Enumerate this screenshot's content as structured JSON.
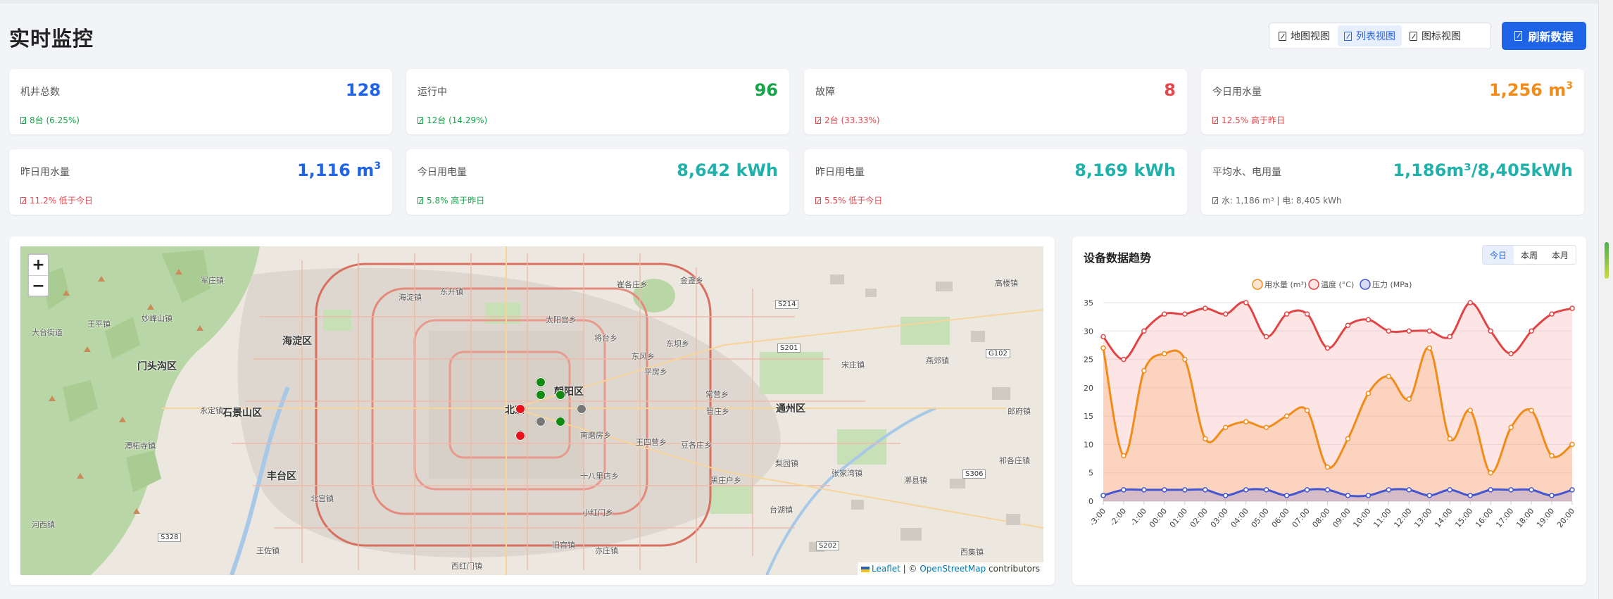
{
  "page": {
    "title": "实时监控"
  },
  "view_switch": {
    "map": "地图视图",
    "list": "列表视图",
    "icon": "图标视图",
    "active": "list"
  },
  "refresh_label": "刷新数据",
  "cards": [
    {
      "label": "机井总数",
      "value": "128",
      "unit": "",
      "color": "#1f63e6",
      "sub": "8台 (6.25%)",
      "sub_color": "#16a34a"
    },
    {
      "label": "运行中",
      "value": "96",
      "unit": "",
      "color": "#16a34a",
      "sub": "12台 (14.29%)",
      "sub_color": "#16a34a"
    },
    {
      "label": "故障",
      "value": "8",
      "unit": "",
      "color": "#e5484d",
      "sub": "2台 (33.33%)",
      "sub_color": "#e5484d"
    },
    {
      "label": "今日用水量",
      "value": "1,256 m",
      "unit": "3",
      "color": "#f08c1a",
      "sub": "12.5% 高于昨日",
      "sub_color": "#e5484d"
    },
    {
      "label": "昨日用水量",
      "value": "1,116 m",
      "unit": "3",
      "color": "#1f63e6",
      "sub": "11.2% 低于今日",
      "sub_color": "#e5484d"
    },
    {
      "label": "今日用电量",
      "value": "8,642 kWh",
      "unit": "",
      "color": "#20b2aa",
      "sub": "5.8% 高于昨日",
      "sub_color": "#16a34a"
    },
    {
      "label": "昨日用电量",
      "value": "8,169 kWh",
      "unit": "",
      "color": "#20b2aa",
      "sub": "5.5% 低于今日",
      "sub_color": "#e5484d"
    },
    {
      "label": "平均水、电用量",
      "value": "1,186m³/8,405kWh",
      "unit": "",
      "color": "#20b2aa",
      "sub": "水: 1,186 m³ | 电: 8,405 kWh",
      "sub_color": "#666"
    }
  ],
  "map": {
    "zoom_in": "+",
    "zoom_out": "−",
    "attribution_leaflet": "Leaflet",
    "attribution_sep": " | © ",
    "attribution_osm": "OpenStreetMap",
    "attribution_tail": " contributors",
    "labels": {
      "haidian": "海淀区",
      "shijingshan": "石景山区",
      "mentougou": "门头沟区",
      "fengtai": "丰台区",
      "chaoyang": "朝阳区",
      "tongzhou": "通州区",
      "beijing": "北京",
      "junzhuang": "军庄镇",
      "miaofengshan": "妙峰山镇",
      "wangping": "王平镇",
      "datai": "大台街道",
      "yongding": "永定镇",
      "tanzhesi": "潭柘寺镇",
      "beigong": "北宫镇",
      "wangzuo": "王佐镇",
      "hexi": "河西镇",
      "haidianzhen": "海淀镇",
      "dongsheng": "东升镇",
      "taiyanggong": "太阳宫乡",
      "jiangtai": "将台乡",
      "cuigezhuang": "崔各庄乡",
      "jinzhan": "金盏乡",
      "dongba": "东坝乡",
      "pingfang": "平房乡",
      "changying": "常营乡",
      "guanzhuang": "管庄乡",
      "songzhuang": "宋庄镇",
      "yanjiao": "燕郊镇",
      "gaolou": "高楼镇",
      "nanmofang": "南磨房乡",
      "wangsiying": "王四营乡",
      "doudian": "豆各庄乡",
      "heizhuanghu": "黑庄户乡",
      "taihu": "台湖镇",
      "liyuan": "梨园镇",
      "zhangjiawan": "张家湾镇",
      "luocheng": "漷县镇",
      "shibalidian": "十八里店乡",
      "xiaohongmen": "小红门乡",
      "jiugong": "旧宫镇",
      "yizhuang": "亦庄镇",
      "xihongmen": "西红门镇",
      "xiji": "西集镇",
      "zhuxinzhuang": "祁各庄镇",
      "jiaozhuang": "郎府镇",
      "dongfengxiang": "东风乡"
    },
    "road_shields": [
      "S214",
      "S201",
      "G102",
      "S306",
      "S202",
      "S328"
    ],
    "markers": [
      {
        "status": "running",
        "color": "#138a12"
      },
      {
        "status": "running",
        "color": "#138a12"
      },
      {
        "status": "running",
        "color": "#138a12"
      },
      {
        "status": "running",
        "color": "#138a12"
      },
      {
        "status": "fault",
        "color": "#e8131a"
      },
      {
        "status": "fault",
        "color": "#e8131a"
      },
      {
        "status": "offline",
        "color": "#777777"
      },
      {
        "status": "offline",
        "color": "#777777"
      }
    ]
  },
  "chart_panel": {
    "title": "设备数据趋势",
    "ranges": [
      "今日",
      "本周",
      "本月"
    ],
    "active_range": "今日"
  },
  "chart_data": {
    "type": "line",
    "x": [
      "-3:00",
      "-2:00",
      "-1:00",
      "00:00",
      "01:00",
      "02:00",
      "03:00",
      "04:00",
      "05:00",
      "06:00",
      "07:00",
      "08:00",
      "09:00",
      "10:00",
      "11:00",
      "12:00",
      "13:00",
      "14:00",
      "15:00",
      "16:00",
      "17:00",
      "18:00",
      "19:00",
      "20:00"
    ],
    "ylim": [
      0,
      35
    ],
    "yticks": [
      0,
      5,
      10,
      15,
      20,
      25,
      30,
      35
    ],
    "grid": true,
    "legend_position": "top",
    "series": [
      {
        "name": "用水量 (m³)",
        "color": "#f08c1a",
        "fill": "rgba(245,166,90,0.28)",
        "values": [
          27,
          8,
          23,
          26,
          25,
          11,
          13,
          14,
          13,
          15,
          16,
          6,
          11,
          19,
          22,
          18,
          27,
          11,
          16,
          5,
          13,
          16,
          8,
          10
        ]
      },
      {
        "name": "温度 (°C)",
        "color": "#e04545",
        "fill": "rgba(250,160,160,0.28)",
        "values": [
          29,
          25,
          30,
          33,
          33,
          34,
          33,
          35,
          29,
          33,
          33,
          27,
          31,
          32,
          30,
          30,
          30,
          29,
          35,
          30,
          26,
          30,
          33,
          34
        ]
      },
      {
        "name": "压力 (MPa)",
        "color": "#4356d0",
        "fill": "rgba(120,130,220,0.28)",
        "values": [
          1,
          2,
          2,
          2,
          2,
          2,
          1,
          2,
          2,
          1,
          2,
          2,
          1,
          1,
          2,
          2,
          1,
          2,
          1,
          2,
          2,
          2,
          1,
          2
        ]
      }
    ]
  }
}
